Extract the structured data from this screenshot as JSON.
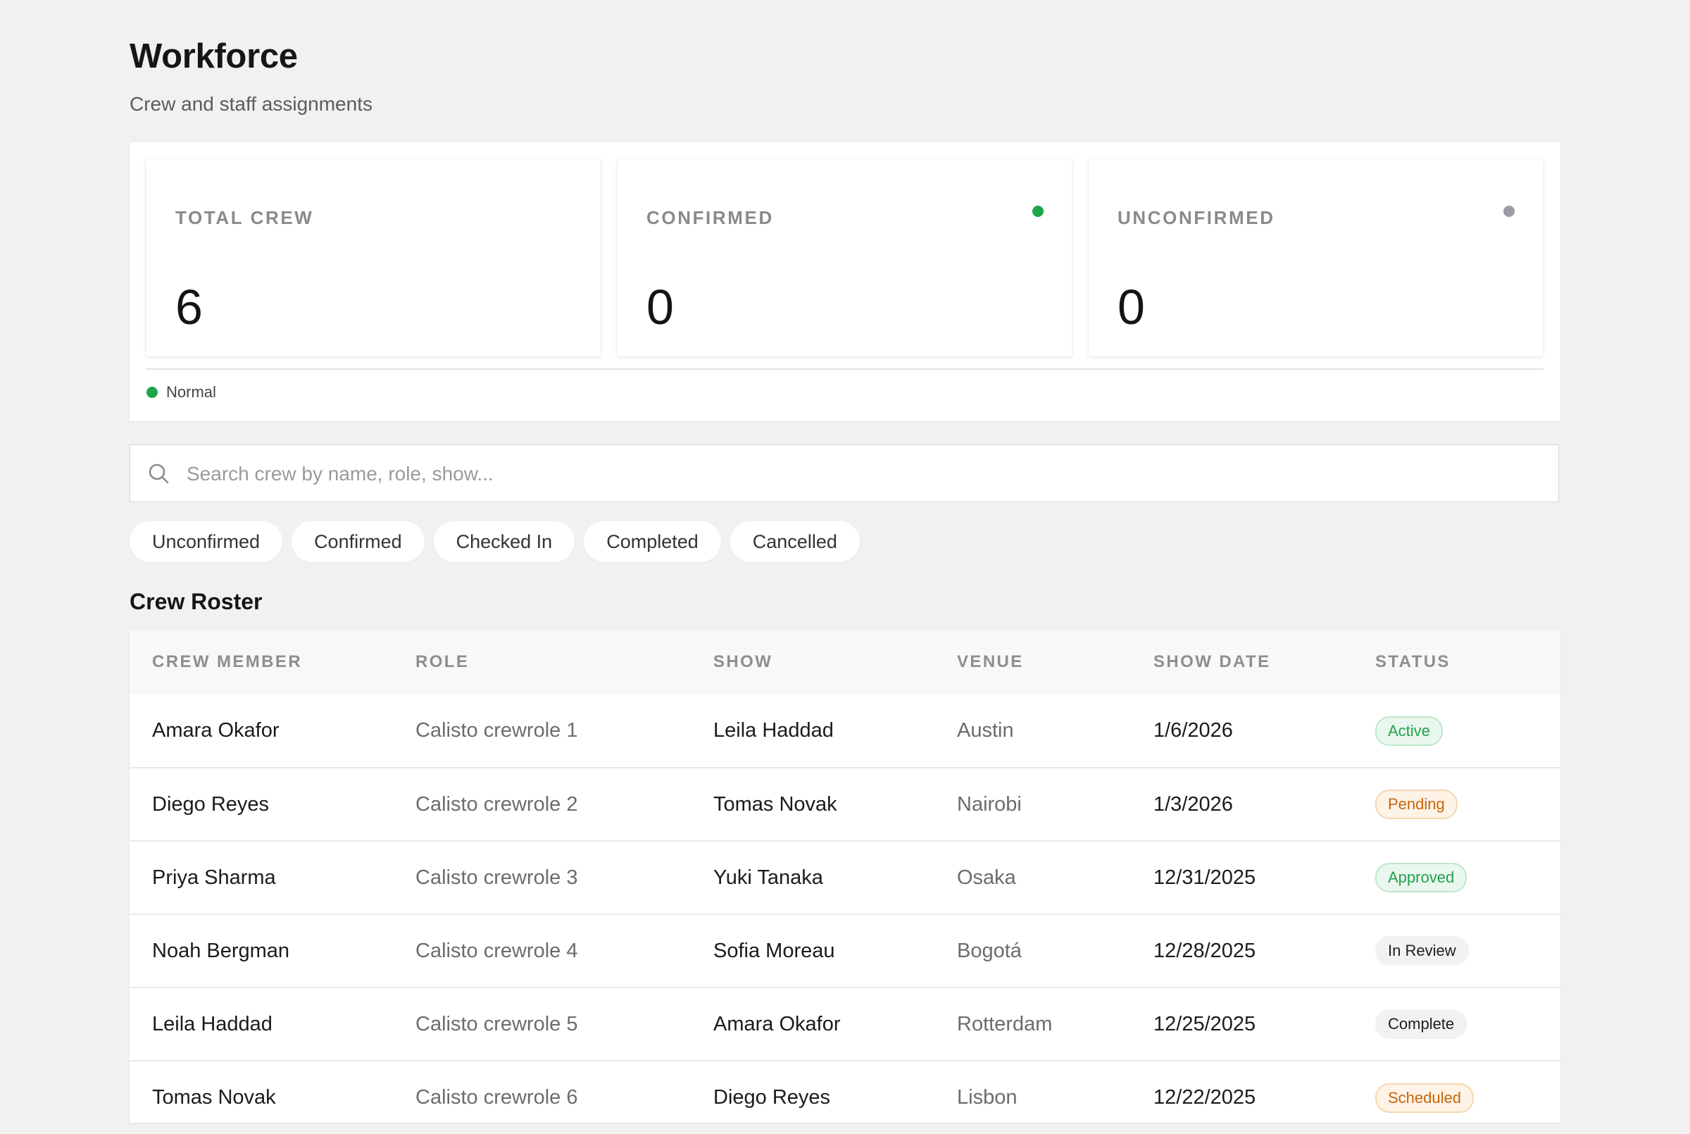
{
  "header": {
    "title": "Workforce",
    "subtitle": "Crew and staff assignments"
  },
  "stats": [
    {
      "label": "TOTAL CREW",
      "value": "6",
      "dot_color": ""
    },
    {
      "label": "CONFIRMED",
      "value": "0",
      "dot_color": "#1fa64a"
    },
    {
      "label": "UNCONFIRMED",
      "value": "0",
      "dot_color": "#9a9ca6"
    }
  ],
  "legend": {
    "label": "Normal",
    "color": "#1fa64a"
  },
  "search": {
    "placeholder": "Search crew by name, role, show...",
    "icon": "search-icon"
  },
  "filters": [
    "Unconfirmed",
    "Confirmed",
    "Checked In",
    "Completed",
    "Cancelled"
  ],
  "roster": {
    "title": "Crew Roster",
    "columns": [
      "CREW MEMBER",
      "ROLE",
      "SHOW",
      "VENUE",
      "SHOW DATE",
      "STATUS"
    ],
    "rows": [
      {
        "member": "Amara Okafor",
        "role": "Calisto crewrole 1",
        "show": "Leila Haddad",
        "venue": "Austin",
        "date": "1/6/2026",
        "status": "Active"
      },
      {
        "member": "Diego Reyes",
        "role": "Calisto crewrole 2",
        "show": "Tomas Novak",
        "venue": "Nairobi",
        "date": "1/3/2026",
        "status": "Pending"
      },
      {
        "member": "Priya Sharma",
        "role": "Calisto crewrole 3",
        "show": "Yuki Tanaka",
        "venue": "Osaka",
        "date": "12/31/2025",
        "status": "Approved"
      },
      {
        "member": "Noah Bergman",
        "role": "Calisto crewrole 4",
        "show": "Sofia Moreau",
        "venue": "Bogotá",
        "date": "12/28/2025",
        "status": "In Review"
      },
      {
        "member": "Leila Haddad",
        "role": "Calisto crewrole 5",
        "show": "Amara Okafor",
        "venue": "Rotterdam",
        "date": "12/25/2025",
        "status": "Complete"
      },
      {
        "member": "Tomas Novak",
        "role": "Calisto crewrole 6",
        "show": "Diego Reyes",
        "venue": "Lisbon",
        "date": "12/22/2025",
        "status": "Scheduled"
      }
    ]
  }
}
